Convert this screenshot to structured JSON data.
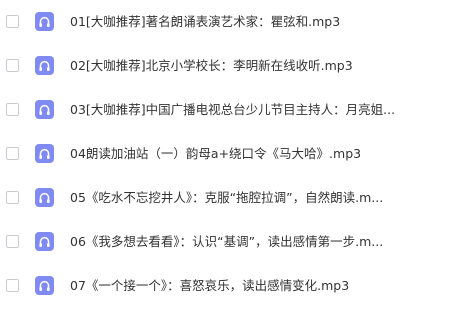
{
  "files": [
    {
      "name": "01[大咖推荐]著名朗诵表演艺术家：瞿弦和.mp3",
      "icon": "audio-file-icon"
    },
    {
      "name": "02[大咖推荐]北京小学校长：李明新在线收听.mp3",
      "icon": "audio-file-icon"
    },
    {
      "name": "03[大咖推荐]中国广播电视总台少儿节目主持人：月亮姐...",
      "icon": "audio-file-icon"
    },
    {
      "name": "04朗读加油站（一）韵母a+绕口令《马大哈》.mp3",
      "icon": "audio-file-icon"
    },
    {
      "name": "05《吃水不忘挖井人》：克服“拖腔拉调”，自然朗读.m...",
      "icon": "audio-file-icon"
    },
    {
      "name": "06《我多想去看看》：认识“基调”，读出感情第一步.m...",
      "icon": "audio-file-icon"
    },
    {
      "name": "07《一个接一个》：喜怒哀乐，读出感情变化.mp3",
      "icon": "audio-file-icon"
    }
  ],
  "colors": {
    "icon_bg": "#7f8bf3",
    "text": "#333333",
    "checkbox_border": "#c9ccd1"
  }
}
